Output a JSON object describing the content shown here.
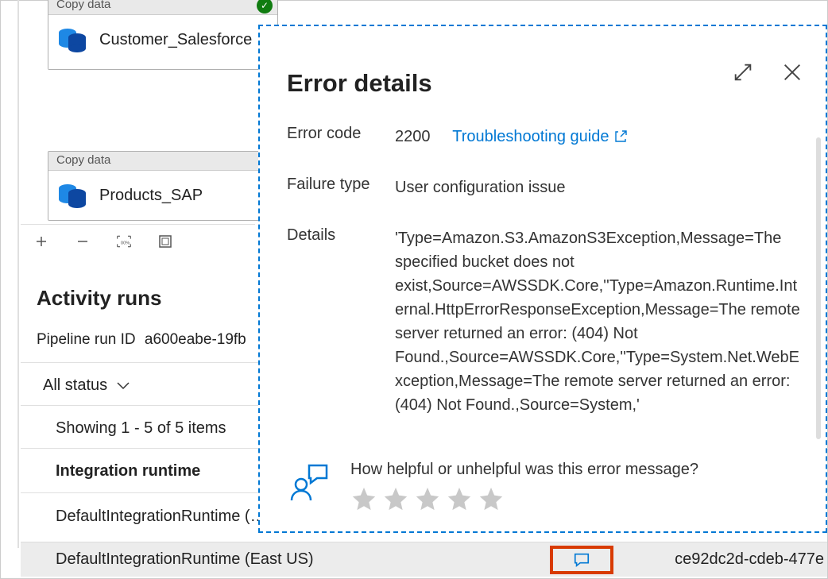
{
  "canvas": {
    "activity1": {
      "type": "Copy data",
      "name": "Customer_Salesforce"
    },
    "activity2": {
      "type": "Copy data",
      "name": "Products_SAP"
    }
  },
  "runs": {
    "heading": "Activity runs",
    "run_id_label": "Pipeline run ID",
    "run_id_value": "a600eabe-19fb",
    "status_filter": "All status",
    "items_count": "Showing 1 - 5 of 5 items",
    "ir_label": "Integration runtime",
    "ir_row1": "DefaultIntegrationRuntime (…",
    "ir_row2": "DefaultIntegrationRuntime (East US)",
    "right_guid": "ce92dc2d-cdeb-477e"
  },
  "panel": {
    "title": "Error details",
    "rows": {
      "error_code_label": "Error code",
      "error_code_value": "2200",
      "troubleshoot": "Troubleshooting guide",
      "failure_type_label": "Failure type",
      "failure_type_value": "User configuration issue",
      "details_label": "Details",
      "details_value": "'Type=Amazon.S3.AmazonS3Exception,Message=The specified bucket does not exist,Source=AWSSDK.Core,''Type=Amazon.Runtime.Internal.HttpErrorResponseException,Message=The remote server returned an error: (404) Not Found.,Source=AWSSDK.Core,''Type=System.Net.WebException,Message=The remote server returned an error: (404) Not Found.,Source=System,'"
    },
    "helpful_q": "How helpful or unhelpful was this error message?"
  }
}
